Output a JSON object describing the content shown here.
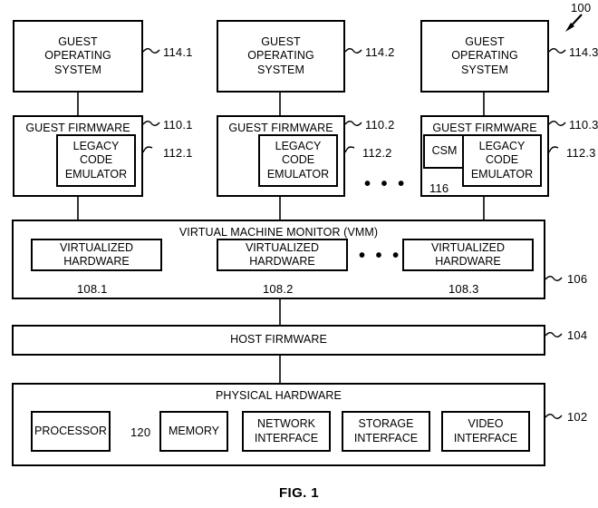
{
  "figure": {
    "caption": "FIG. 1",
    "system_ref": "100"
  },
  "guest_os": [
    {
      "label": "GUEST\nOPERATING\nSYSTEM",
      "ref": "114.1"
    },
    {
      "label": "GUEST\nOPERATING\nSYSTEM",
      "ref": "114.2"
    },
    {
      "label": "GUEST\nOPERATING\nSYSTEM",
      "ref": "114.3"
    }
  ],
  "guest_firmware": [
    {
      "label": "GUEST FIRMWARE",
      "ref": "110.1",
      "emulator_label": "LEGACY\nCODE\nEMULATOR",
      "emulator_ref": "112.1"
    },
    {
      "label": "GUEST FIRMWARE",
      "ref": "110.2",
      "emulator_label": "LEGACY\nCODE\nEMULATOR",
      "emulator_ref": "112.2"
    },
    {
      "label": "GUEST FIRMWARE",
      "ref": "110.3",
      "emulator_label": "LEGACY\nCODE\nEMULATOR",
      "emulator_ref": "112.3",
      "csm_label": "CSM",
      "csm_ref": "116"
    }
  ],
  "vmm": {
    "title": "VIRTUAL MACHINE MONITOR (VMM)",
    "ref": "106",
    "virtualized_hardware": [
      {
        "label": "VIRTUALIZED\nHARDWARE",
        "ref": "108.1"
      },
      {
        "label": "VIRTUALIZED\nHARDWARE",
        "ref": "108.2"
      },
      {
        "label": "VIRTUALIZED\nHARDWARE",
        "ref": "108.3"
      }
    ]
  },
  "host_firmware": {
    "label": "HOST FIRMWARE",
    "ref": "104"
  },
  "physical_hardware": {
    "title": "PHYSICAL HARDWARE",
    "ref": "102",
    "components": [
      {
        "label": "PROCESSOR",
        "ref": "120"
      },
      {
        "label": "MEMORY",
        "ref": ""
      },
      {
        "label": "NETWORK\nINTERFACE",
        "ref": ""
      },
      {
        "label": "STORAGE\nINTERFACE",
        "ref": ""
      },
      {
        "label": "VIDEO\nINTERFACE",
        "ref": ""
      }
    ]
  },
  "ellipses": {
    "firmware_row": "• • •",
    "vmm_row": "• • •"
  }
}
